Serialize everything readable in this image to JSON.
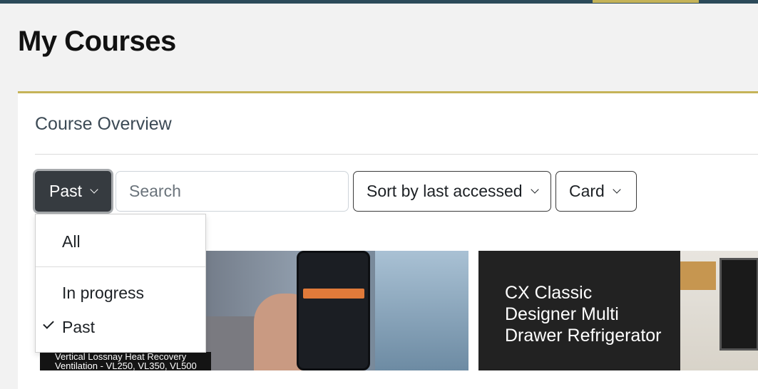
{
  "page": {
    "title": "My Courses"
  },
  "overview": {
    "title": "Course Overview",
    "filter": {
      "selected": "Past",
      "options": [
        "All",
        "In progress",
        "Past"
      ]
    },
    "search": {
      "placeholder": "Search",
      "value": ""
    },
    "sort": {
      "label": "Sort by last accessed"
    },
    "view": {
      "label": "Card"
    }
  },
  "courses": [
    {
      "image_caption": "Vertical Lossnay Heat Recovery Ventilation - VL250, VL350, VL500"
    },
    {
      "image_title": "CX Classic Designer Multi Drawer Refrigerator"
    }
  ],
  "colors": {
    "accent": "#c5b358",
    "topbar": "#2c4a5a",
    "selected_button": "#363b40"
  },
  "icons": [
    "chevron-down-icon",
    "check-icon"
  ]
}
